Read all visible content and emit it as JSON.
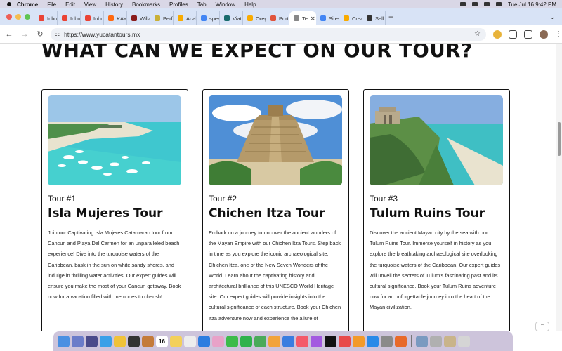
{
  "menubar": {
    "app": "Chrome",
    "items": [
      "File",
      "Edit",
      "View",
      "History",
      "Bookmarks",
      "Profiles",
      "Tab",
      "Window",
      "Help"
    ],
    "clock": "Tue Jul 16  9:42 PM"
  },
  "tabs": [
    {
      "label": "Inbox",
      "color": "#ea4335"
    },
    {
      "label": "Inbox",
      "color": "#ea4335"
    },
    {
      "label": "Inbox",
      "color": "#ea4335"
    },
    {
      "label": "KAYAK",
      "color": "#ff690f"
    },
    {
      "label": "Willar",
      "color": "#8a1c1c"
    },
    {
      "label": "Perfo",
      "color": "#c9b037"
    },
    {
      "label": "Analy",
      "color": "#f9ab00"
    },
    {
      "label": "speec",
      "color": "#4285f4"
    },
    {
      "label": "Viator",
      "color": "#186b6d"
    },
    {
      "label": "Orego",
      "color": "#f9ab00"
    },
    {
      "label": "Portla",
      "color": "#e0543c"
    },
    {
      "label": "Te",
      "color": "#888888",
      "active": true
    },
    {
      "label": "Sites",
      "color": "#4285f4"
    },
    {
      "label": "Creat",
      "color": "#f9ab00"
    },
    {
      "label": "Sell o",
      "color": "#333333"
    }
  ],
  "address": {
    "url": "https://www.yucatantours.mx"
  },
  "page": {
    "headline": "WHAT CAN WE EXPECT ON OUR TOUR?",
    "tours": [
      {
        "number": "Tour #1",
        "name": "Isla Mujeres Tour",
        "description": "Join our Captivating Isla Mujeres Catamaran tour from Cancun and Playa Del Carmen for an unparalleled beach experience! Dive into the turquoise waters of the Caribbean, bask in the sun on white sandy shores, and indulge in thrilling water activities. Our expert guides will ensure you make the most of your Cancun getaway. Book now for a vacation filled with memories to cherish!"
      },
      {
        "number": "Tour #2",
        "name": "Chichen Itza Tour",
        "description": "Embark on a journey to uncover the ancient wonders of the Mayan Empire with our Chichen Itza Tours. Step back in time as you explore the iconic archaeological site, Chichen Itza, one of the New Seven Wonders of the World. Learn about the captivating history and architectural brilliance of this UNESCO World Heritage site. Our expert guides will provide insights into the cultural significance of each structure. Book your Chichen Itza adventure now and experience the allure of"
      },
      {
        "number": "Tour #3",
        "name": "Tulum Ruins Tour",
        "description": "Discover the ancient Mayan city by the sea with our Tulum Ruins Tour. Immerse yourself in history as you explore the breathtaking archaeological site overlooking the turquoise waters of the Caribbean. Our expert guides will unveil the secrets of Tulum's fascinating past and its cultural significance. Book your Tulum Ruins adventure now for an unforgettable journey into the heart of the Mayan civilization."
      }
    ]
  },
  "dock": {
    "calendar_day": "16"
  }
}
